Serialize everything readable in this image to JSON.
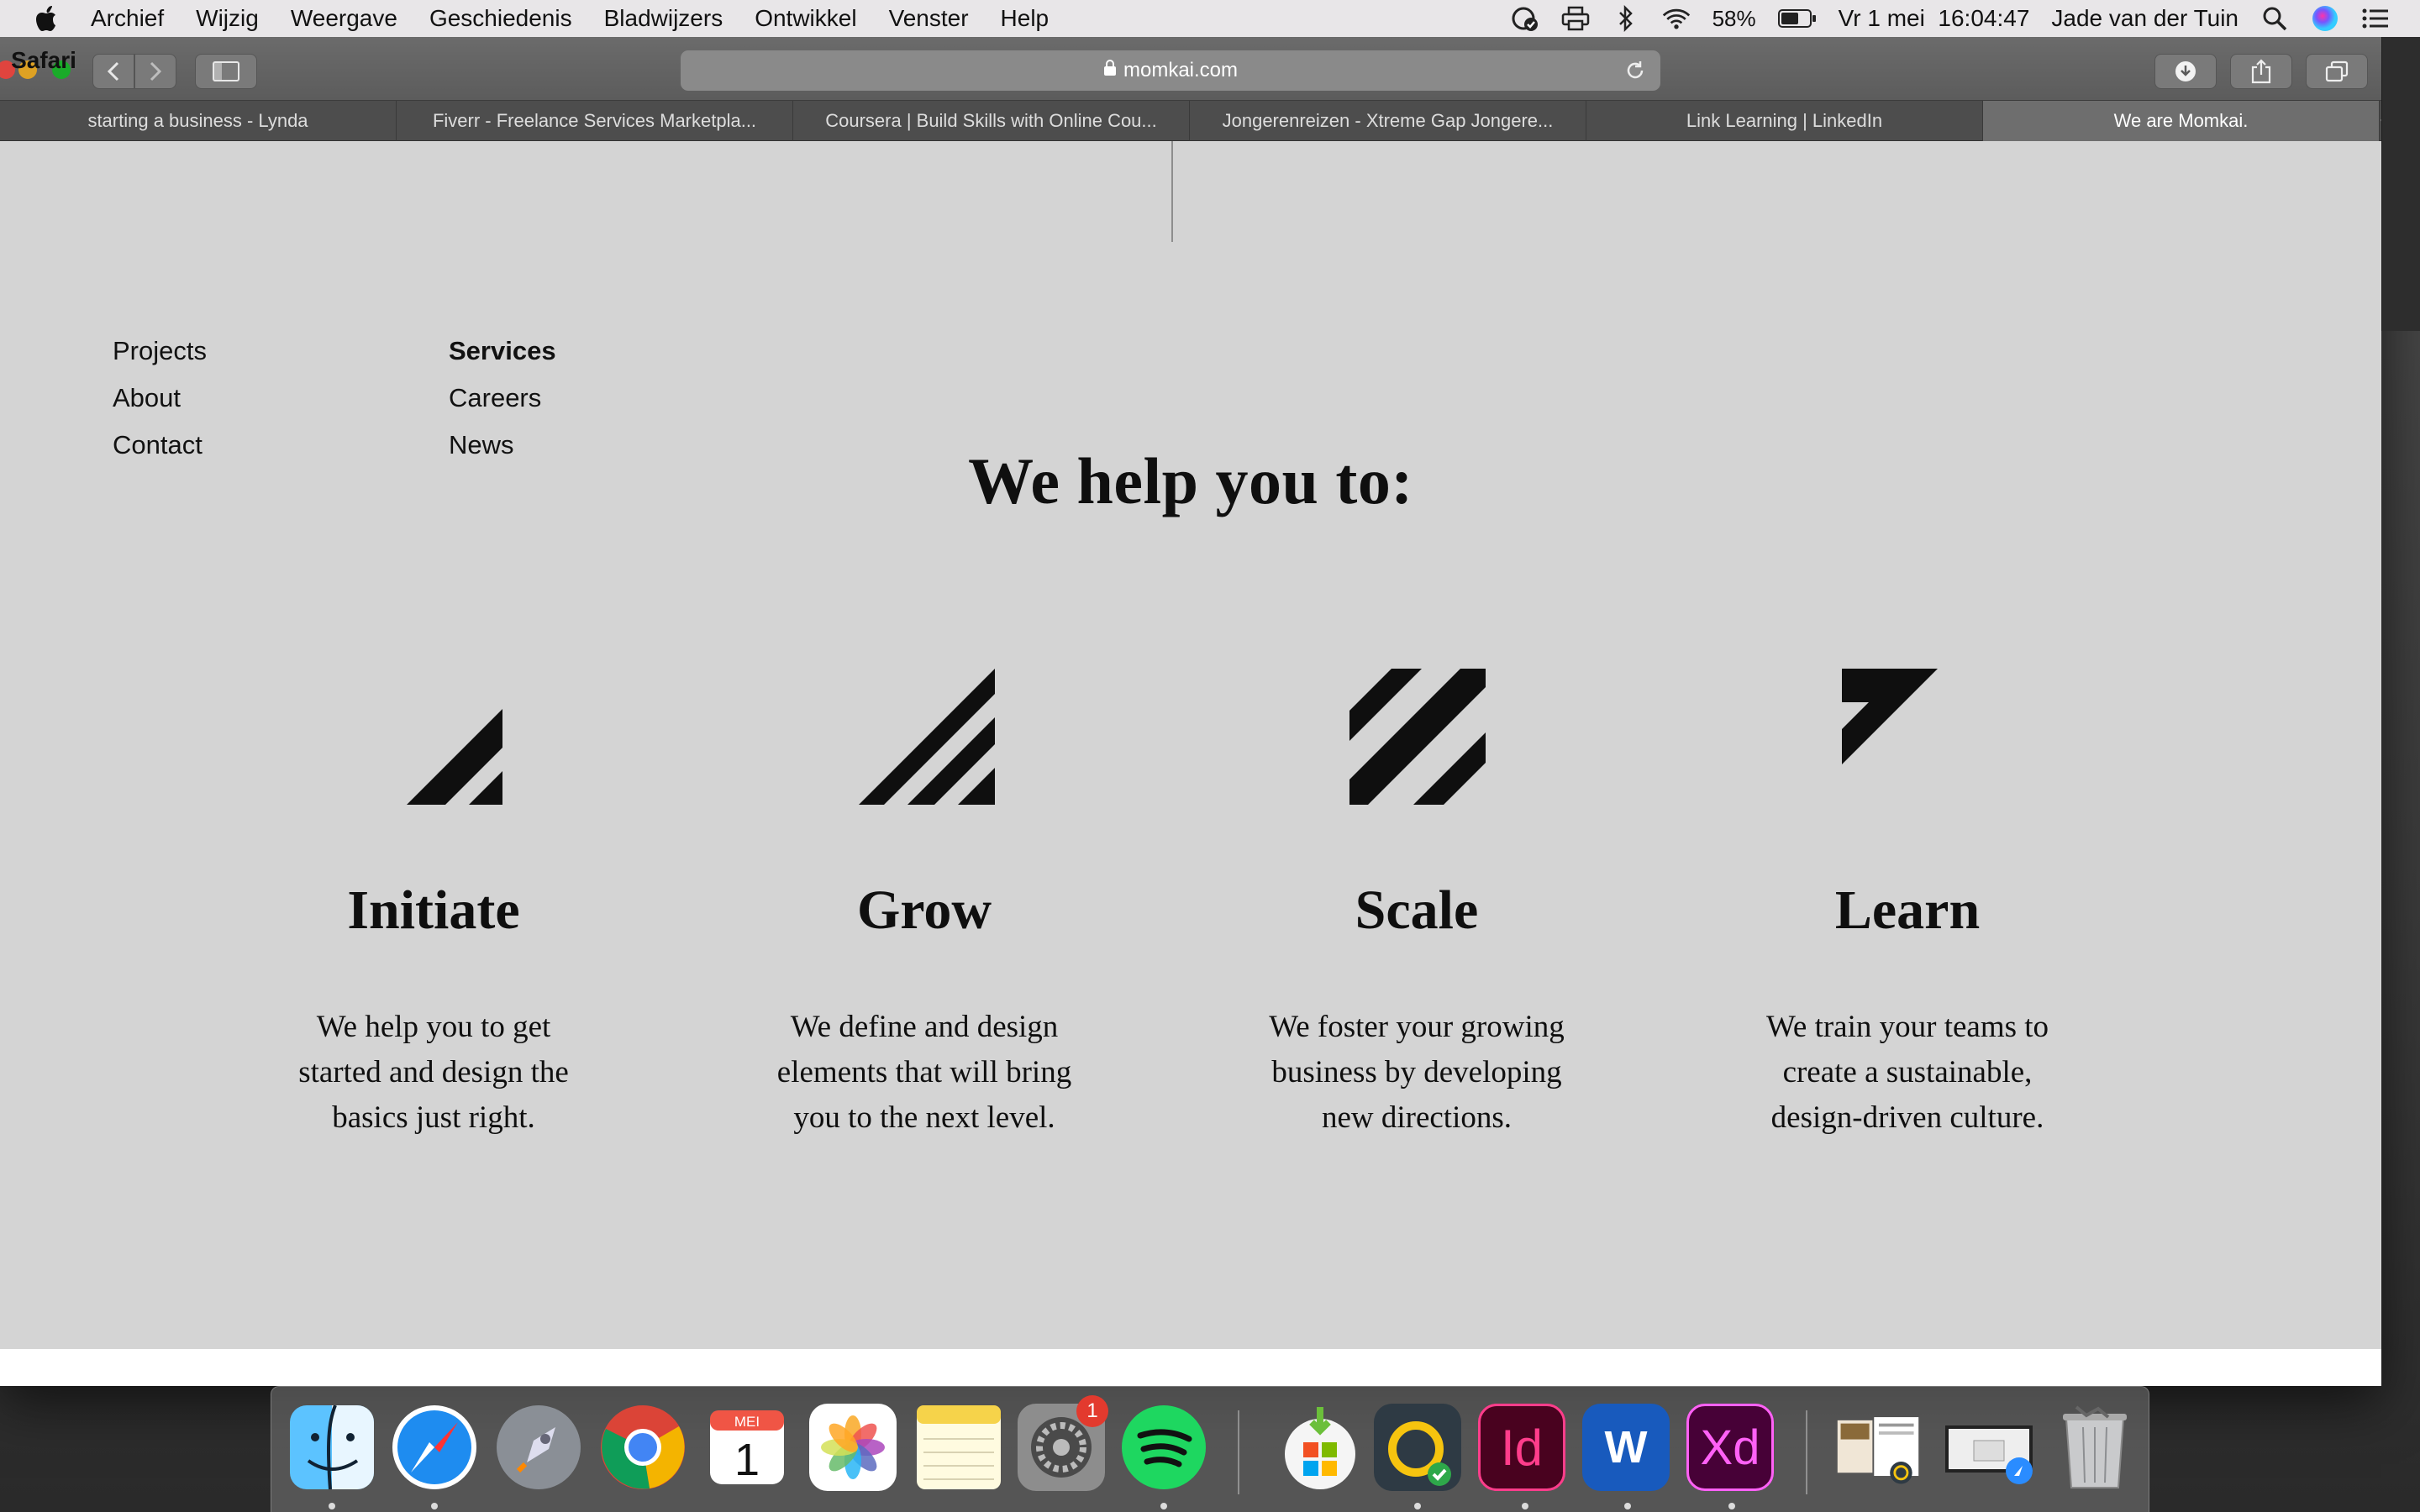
{
  "menubar": {
    "app_name": "Safari",
    "items": [
      "Archief",
      "Wijzig",
      "Weergave",
      "Geschiedenis",
      "Bladwijzers",
      "Ontwikkel",
      "Venster",
      "Help"
    ],
    "battery": "58%",
    "datetime": "Vr 1 mei  16:04:47",
    "user": "Jade van der Tuin"
  },
  "browser": {
    "url": "momkai.com",
    "tabs": [
      {
        "label": "starting a business - Lynda",
        "active": false
      },
      {
        "label": "Fiverr - Freelance Services Marketpla...",
        "active": false
      },
      {
        "label": "Coursera | Build Skills with Online Cou...",
        "active": false
      },
      {
        "label": "Jongerenreizen - Xtreme Gap Jongere...",
        "active": false
      },
      {
        "label": "Link Learning | LinkedIn",
        "active": false
      },
      {
        "label": "We are Momkai.",
        "active": true
      }
    ]
  },
  "page": {
    "nav_left": [
      "Projects",
      "About",
      "Contact"
    ],
    "nav_right": [
      "Services",
      "Careers",
      "News"
    ],
    "headline": "We help you to:",
    "services": [
      {
        "title": "Initiate",
        "icon": "initiate-stripes-icon",
        "lines": [
          "We help you to get",
          "started and design the",
          "basics just right."
        ]
      },
      {
        "title": "Grow",
        "icon": "grow-stripes-icon",
        "lines": [
          "We define and design",
          "elements that will bring",
          "you to the next level."
        ]
      },
      {
        "title": "Scale",
        "icon": "scale-stripes-icon",
        "lines": [
          "We foster your growing",
          "business by developing",
          "new directions."
        ]
      },
      {
        "title": "Learn",
        "icon": "learn-stripe-icon",
        "lines": [
          "We train your teams to",
          "create a sustainable,",
          "design-driven culture."
        ]
      }
    ]
  },
  "dock": {
    "calendar_month": "MEI",
    "calendar_day": "1",
    "system_prefs_badge": "1",
    "indesign_label": "Id",
    "word_label": "W",
    "xd_label": "Xd"
  },
  "colors": {
    "page_bg": "#d4d4d4",
    "text": "#0f0f0f",
    "menubar_bg": "#e8e6e8",
    "toolbar_bg": "#656565",
    "tab_active": "#6e6e6e"
  }
}
